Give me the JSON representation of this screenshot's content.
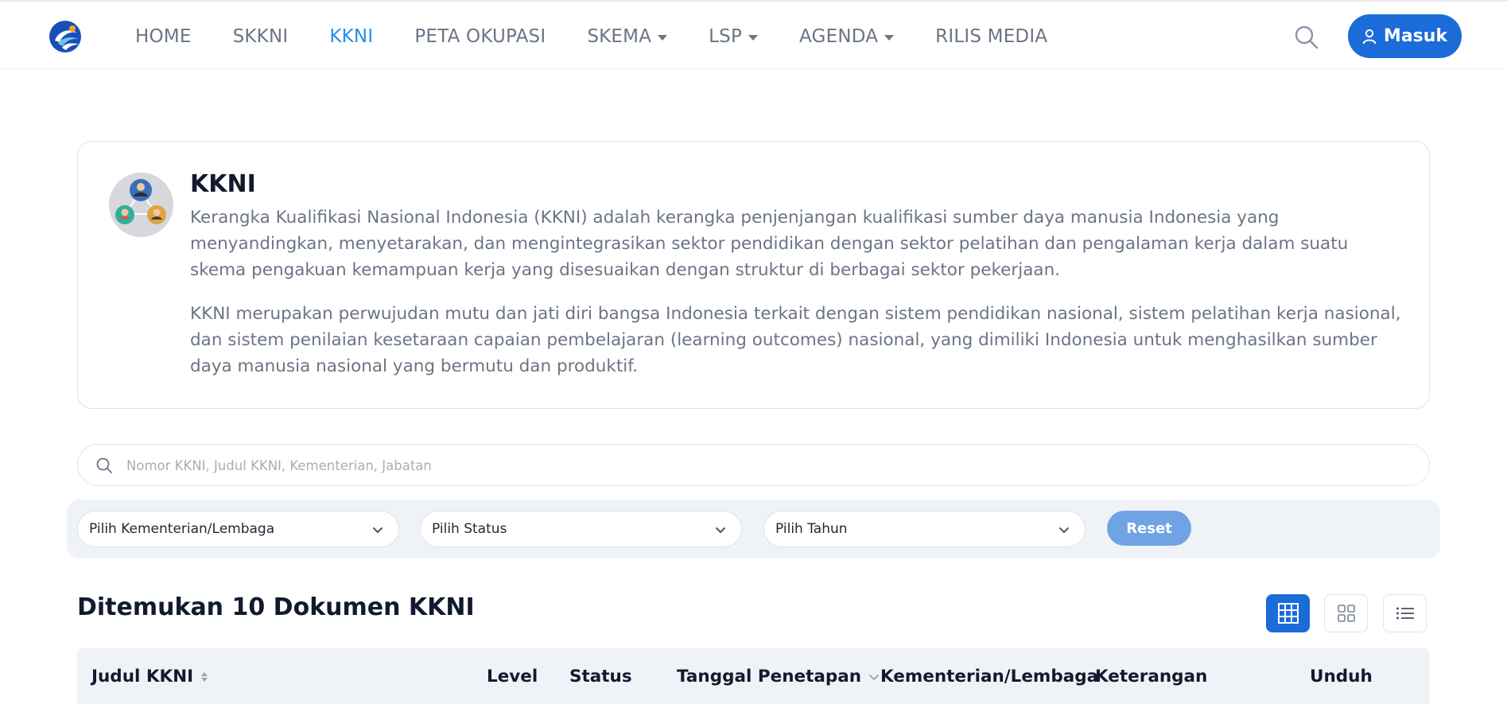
{
  "header": {
    "logo": "kominfo-logo",
    "nav": [
      {
        "label": "HOME",
        "dropdown": false,
        "active": false
      },
      {
        "label": "SKKNI",
        "dropdown": false,
        "active": false
      },
      {
        "label": "KKNI",
        "dropdown": false,
        "active": true
      },
      {
        "label": "PETA OKUPASI",
        "dropdown": false,
        "active": false
      },
      {
        "label": "SKEMA",
        "dropdown": true,
        "active": false
      },
      {
        "label": "LSP",
        "dropdown": true,
        "active": false
      },
      {
        "label": "AGENDA",
        "dropdown": true,
        "active": false
      },
      {
        "label": "RILIS MEDIA",
        "dropdown": false,
        "active": false
      }
    ],
    "search_icon": "search-icon",
    "login_label": "Masuk"
  },
  "info": {
    "title": "KKNI",
    "paragraph1": "Kerangka Kualifikasi Nasional Indonesia (KKNI) adalah kerangka penjenjangan kualifikasi sumber daya manusia Indonesia yang menyandingkan, menyetarakan, dan mengintegrasikan sektor pendidikan dengan sektor pelatihan dan pengalaman kerja dalam suatu skema pengakuan kemampuan kerja yang disesuaikan dengan struktur di berbagai sektor pekerjaan.",
    "paragraph2": "KKNI merupakan perwujudan mutu dan jati diri bangsa Indonesia terkait dengan sistem pendidikan nasional, sistem pelatihan kerja nasional, dan sistem penilaian kesetaraan capaian pembelajaran (learning outcomes) nasional, yang dimiliki Indonesia untuk menghasilkan sumber daya manusia nasional yang bermutu dan produktif."
  },
  "search": {
    "placeholder": "Nomor KKNI, Judul KKNI, Kementerian, Jabatan",
    "value": ""
  },
  "filters": {
    "kementerian": "Pilih Kementerian/Lembaga",
    "status": "Pilih Status",
    "tahun": "Pilih Tahun",
    "reset_label": "Reset"
  },
  "results": {
    "title": "Ditemukan 10 Dokumen KKNI",
    "views": [
      "table-view-icon",
      "grid-view-icon",
      "list-view-icon"
    ],
    "active_view": "table-view-icon"
  },
  "table": {
    "columns": [
      "Judul KKNI",
      "Level",
      "Status",
      "Tanggal Penetapan",
      "Kementerian/Lembaga",
      "Keterangan",
      "Unduh"
    ]
  },
  "colors": {
    "primary": "#1b6bd8",
    "nav_active": "#2b8de8",
    "nav_text": "#6b7485",
    "panel_bg": "#eff3f7",
    "reset_btn": "#70a3e4"
  }
}
